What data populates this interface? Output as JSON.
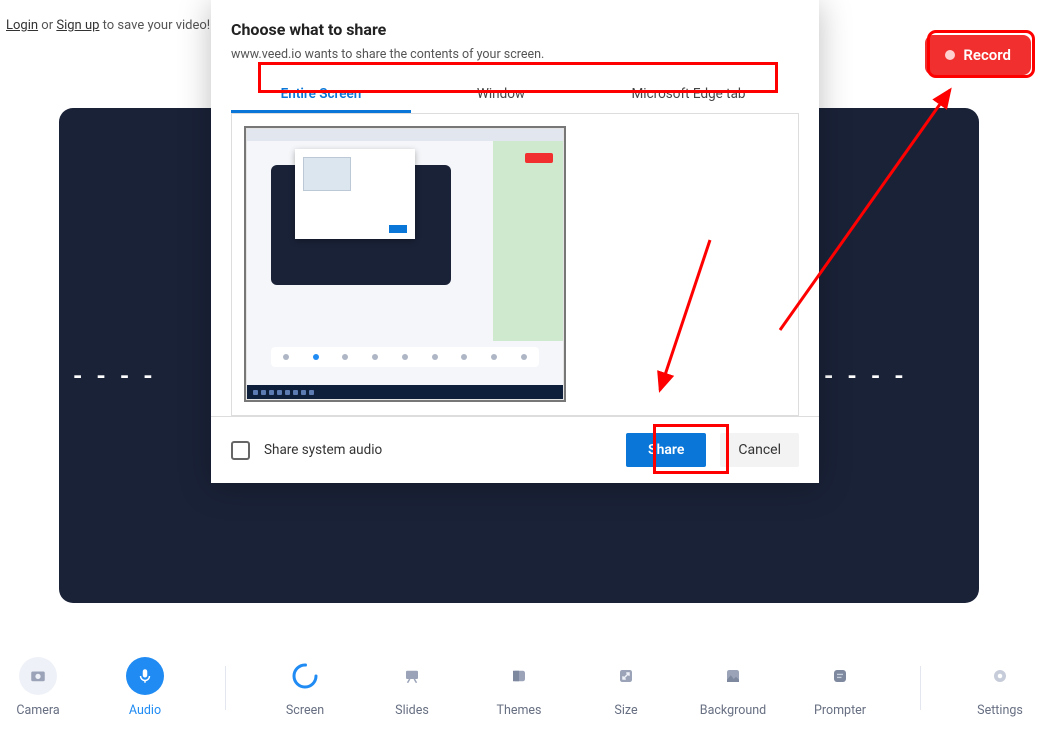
{
  "top": {
    "login": "Login",
    "or": "or",
    "signup": "Sign up",
    "save_hint": "to save your video!"
  },
  "record": {
    "label": "Record"
  },
  "dialog": {
    "title": "Choose what to share",
    "subtitle": "www.veed.io wants to share the contents of your screen.",
    "tabs": {
      "entire": "Entire Screen",
      "window": "Window",
      "edge": "Microsoft Edge tab"
    },
    "footer": {
      "share_audio": "Share system audio",
      "share": "Share",
      "cancel": "Cancel"
    }
  },
  "toolbar": {
    "camera": "Camera",
    "audio": "Audio",
    "screen": "Screen",
    "slides": "Slides",
    "themes": "Themes",
    "size": "Size",
    "background": "Background",
    "prompter": "Prompter",
    "settings": "Settings"
  }
}
